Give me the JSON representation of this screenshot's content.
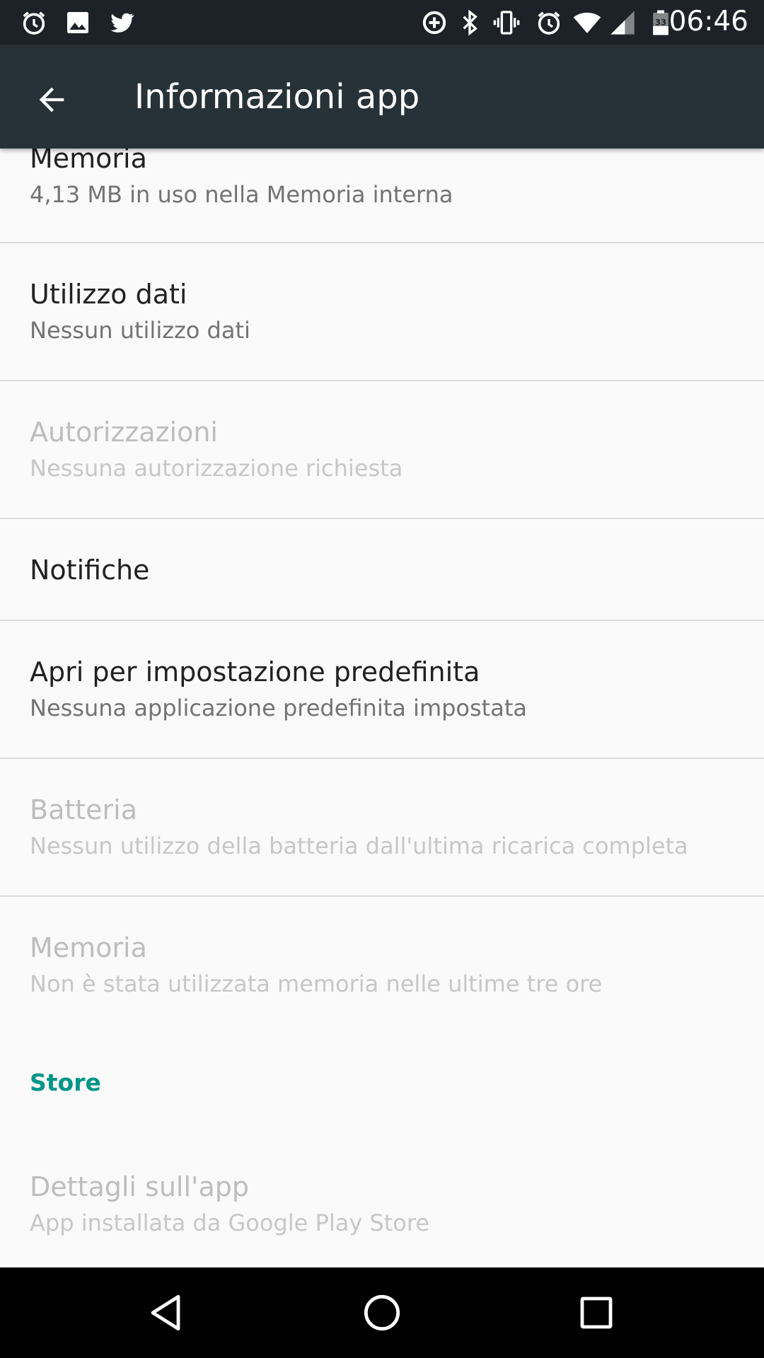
{
  "status_bar": {
    "time": "06:46",
    "battery_level": "33",
    "left_icons": [
      "alarm-icon",
      "image-icon",
      "twitter-icon"
    ],
    "right_icons": [
      "data-saver-icon",
      "bluetooth-icon",
      "vibrate-icon",
      "alarm-icon",
      "wifi-icon",
      "signal-icon",
      "battery-icon"
    ]
  },
  "toolbar": {
    "title": "Informazioni app",
    "back_icon": "arrow-back-icon"
  },
  "list": {
    "items": [
      {
        "title": "Memoria",
        "subtitle": "4,13 MB in uso nella Memoria interna",
        "enabled": true
      },
      {
        "title": "Utilizzo dati",
        "subtitle": "Nessun utilizzo dati",
        "enabled": true
      },
      {
        "title": "Autorizzazioni",
        "subtitle": "Nessuna autorizzazione richiesta",
        "enabled": false
      },
      {
        "title": "Notifiche",
        "subtitle": "",
        "enabled": true
      },
      {
        "title": "Apri per impostazione predefinita",
        "subtitle": "Nessuna applicazione predefinita impostata",
        "enabled": true
      },
      {
        "title": "Batteria",
        "subtitle": "Nessun utilizzo della batteria dall'ultima ricarica completa",
        "enabled": false
      },
      {
        "title": "Memoria",
        "subtitle": "Non è stata utilizzata memoria nelle ultime tre ore",
        "enabled": false
      }
    ],
    "section_header": "Store",
    "store_item": {
      "title": "Dettagli sull'app",
      "subtitle": "App installata da Google Play Store",
      "enabled": false
    }
  },
  "colors": {
    "status_bar": "#1c2227",
    "toolbar": "#263238",
    "accent": "#009688",
    "background": "#fafafa"
  },
  "nav_bar": {
    "buttons": [
      "back-triangle-icon",
      "home-circle-icon",
      "recents-square-icon"
    ]
  }
}
